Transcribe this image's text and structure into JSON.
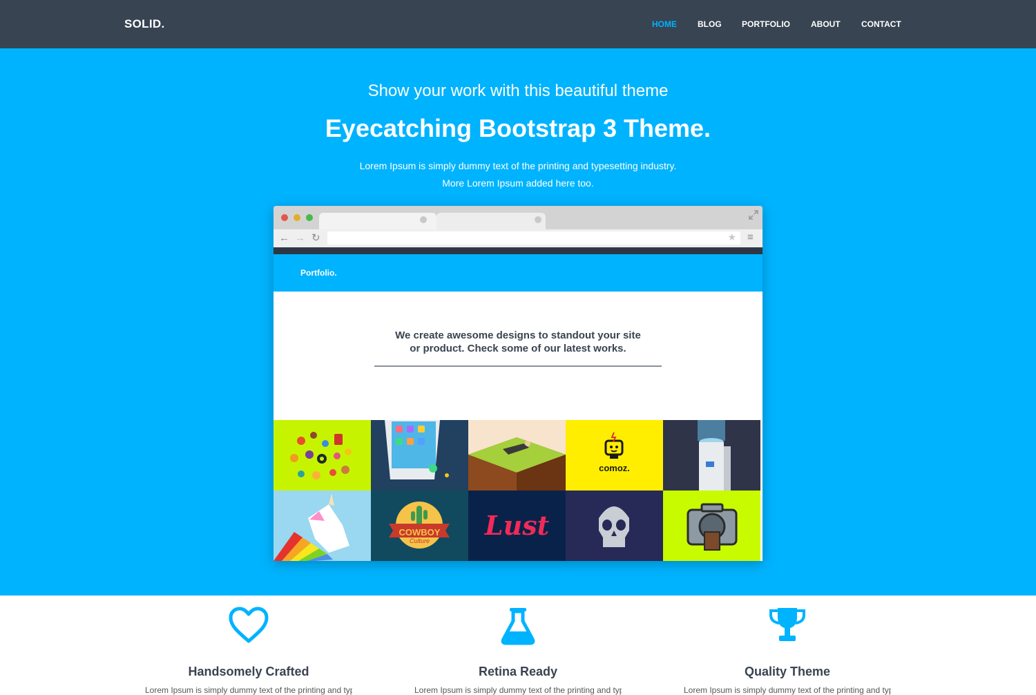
{
  "nav": {
    "brand": "SOLID.",
    "items": [
      "HOME",
      "BLOG",
      "PORTFOLIO",
      "ABOUT",
      "CONTACT"
    ],
    "active": "HOME"
  },
  "hero": {
    "subtitle": "Show your work with this beautiful theme",
    "title": "Eyecatching Bootstrap 3 Theme.",
    "lead_line1": "Lorem Ipsum is simply dummy text of the printing and typesetting industry.",
    "lead_line2": "More Lorem Ipsum added here too."
  },
  "mockup": {
    "brand": "Portfolio.",
    "headline_line1": "We create awesome designs to standout your site",
    "headline_line2": "or product. Check some of our latest works.",
    "tiles": [
      {
        "name": "food-items-illustration",
        "bg": "#c6f400"
      },
      {
        "name": "phone-apps-illustration",
        "bg": "#22405f"
      },
      {
        "name": "man-on-grass-illustration",
        "bg": "#b7dd3e"
      },
      {
        "name": "comoz-logo-tile",
        "bg": "#ffee00",
        "label": "comoz."
      },
      {
        "name": "water-cooler-illustration",
        "bg": "#2f3449"
      },
      {
        "name": "rainbow-unicorn-illustration",
        "bg": "#9ad7f0"
      },
      {
        "name": "cowboy-culture-badge",
        "bg": "#114a5e",
        "label": "COWBOY",
        "label2": "Culture"
      },
      {
        "name": "lust-lettering-tile",
        "bg": "#09224a",
        "label": "Lust"
      },
      {
        "name": "skull-illustration",
        "bg": "#272a57"
      },
      {
        "name": "camera-monster-illustration",
        "bg": "#c8fa00"
      }
    ]
  },
  "features": [
    {
      "icon": "heart-icon",
      "name": "Handsomely Crafted",
      "desc": "Lorem Ipsum is simply dummy text of the printing and typesetting industry."
    },
    {
      "icon": "flask-icon",
      "name": "Retina Ready",
      "desc": "Lorem Ipsum is simply dummy text of the printing and typesetting industry."
    },
    {
      "icon": "trophy-icon",
      "name": "Quality Theme",
      "desc": "Lorem Ipsum is simply dummy text of the printing and typesetting industry."
    }
  ],
  "colors": {
    "navbar": "#384452",
    "accent": "#00b3fe",
    "text_dark": "#3a4350"
  }
}
